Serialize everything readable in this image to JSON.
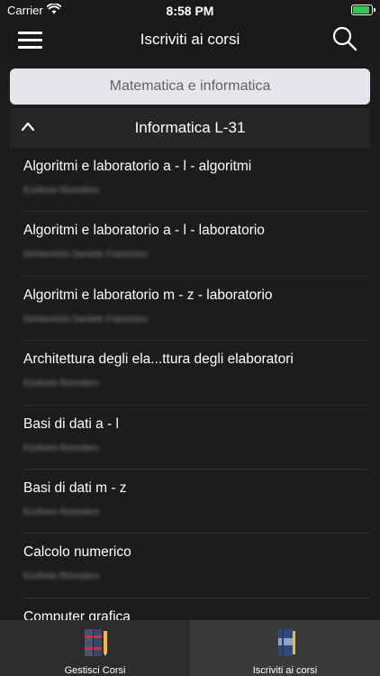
{
  "status": {
    "carrier": "Carrier",
    "time": "8:58 PM"
  },
  "nav": {
    "title": "Iscriviti ai corsi"
  },
  "department": {
    "label": "Matematica e informatica"
  },
  "section": {
    "label": "Informatica L-31"
  },
  "courses": [
    {
      "name": "Algoritmi e laboratorio a - l - algoritmi",
      "teacher": "Ezzilorie Romolero"
    },
    {
      "name": "Algoritmi e laboratorio a - l - laboratorio",
      "teacher": "Dentemerio Daniele Francesco"
    },
    {
      "name": "Algoritmi e laboratorio m - z - laboratorio",
      "teacher": "Dentemerio Daniele Francesco"
    },
    {
      "name": "Architettura degli ela...ttura degli elaboratori",
      "teacher": "Ezzilorie Romolero"
    },
    {
      "name": "Basi di dati a - l",
      "teacher": "Ezzilorie Romolero"
    },
    {
      "name": "Basi di dati m - z",
      "teacher": "Ezzilorie Romolero"
    },
    {
      "name": "Calcolo numerico",
      "teacher": "Ezzilorie Romolero"
    },
    {
      "name": "Computer grafica",
      "teacher": ""
    }
  ],
  "tabs": [
    {
      "label": "Gestisci Corsi",
      "icon": "books-pencil-icon",
      "active": false
    },
    {
      "label": "Iscriviti ai corsi",
      "icon": "book-icon",
      "active": true
    }
  ],
  "colors": {
    "background": "#1c1c1e",
    "department_button": "#e5e5ea",
    "battery": "#34c759",
    "tab_active": "#3a3a3c"
  }
}
